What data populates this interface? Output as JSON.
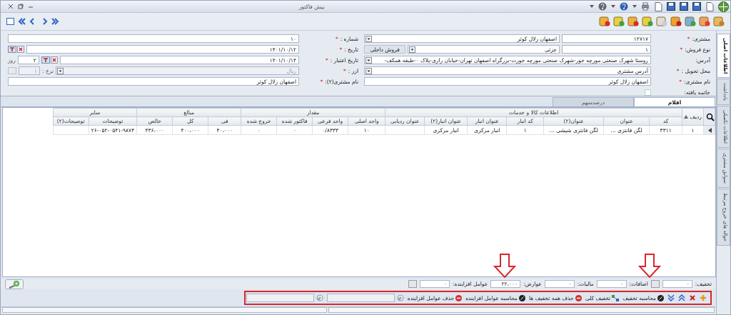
{
  "window": {
    "title": "پیش فاکتور"
  },
  "header_form": {
    "right": [
      {
        "label": "مشتری:",
        "required": "*",
        "fields": [
          {
            "kind": "code",
            "value": "۱۲۷۱۷",
            "disabled": false
          },
          {
            "kind": "combo",
            "value": "اصفهان زلال کوثر",
            "disabled": false
          }
        ]
      },
      {
        "label": "نوع فروش:",
        "required": "*",
        "fields": [
          {
            "kind": "code",
            "value": "۱",
            "disabled": false
          },
          {
            "kind": "combo",
            "value": "جزئی",
            "disabled": false
          },
          {
            "kind": "tag",
            "value": "فروش داخلی"
          }
        ]
      },
      {
        "label": "آدرس:",
        "fields": [
          {
            "kind": "combo",
            "value": "روستا شهرک صنعتی مورچه خور-شهرک صنعتی مورچه خورت-بزرگراه اصفهان تهران-خیابان رازی-پلاک ۰-طبقه همکف-",
            "disabled": false
          }
        ]
      },
      {
        "label": "محل تحویل :",
        "required": "*",
        "fields": [
          {
            "kind": "combo",
            "value": "آدرس مشتری",
            "disabled": false
          }
        ]
      },
      {
        "label": "نام مشتری:",
        "required": "*",
        "fields": [
          {
            "kind": "input",
            "value": "اصفهان زلال کوثر",
            "disabled": false
          }
        ]
      },
      {
        "label": "خاتمه یافته:",
        "fields": [
          {
            "kind": "checkbox",
            "checked": false
          }
        ]
      }
    ],
    "left": [
      {
        "label": "شماره :",
        "required": "*",
        "fields": [
          {
            "kind": "input",
            "value": "۱۰",
            "disabled": false
          }
        ]
      },
      {
        "label": "تاریخ :",
        "required": "*",
        "fields": [
          {
            "kind": "input",
            "value": "۱۴۰۱/۱۰/۱۲",
            "disabled": false
          },
          {
            "kind": "date-tools"
          }
        ]
      },
      {
        "label": "تاریخ اعتبار :",
        "required": "*",
        "fields": [
          {
            "kind": "input",
            "value": "۱۴۰۱/۱۰/۱۴",
            "disabled": false
          },
          {
            "kind": "date-tools"
          },
          {
            "kind": "small",
            "value": "۲",
            "disabled": false
          },
          {
            "kind": "unit",
            "value": "روز"
          }
        ]
      },
      {
        "label": "ارز :",
        "required": "*",
        "fields": [
          {
            "kind": "combo",
            "value": "ریال",
            "disabled": true
          },
          {
            "kind": "unit",
            "value": "نرخ :"
          },
          {
            "kind": "small",
            "value": "۱",
            "disabled": true
          },
          {
            "kind": "button",
            "disabled": true
          }
        ]
      },
      {
        "label": "نام مشتری(۲):",
        "required": "*",
        "fields": [
          {
            "kind": "input",
            "value": "اصفهان زلال کوثر",
            "disabled": false
          }
        ]
      }
    ]
  },
  "tabs": [
    {
      "label": "اقلام",
      "selected": true
    },
    {
      "label": "درصدسهم",
      "selected": false
    }
  ],
  "side_tabs": [
    {
      "label": "اطلاعات اصلی",
      "selected": true
    },
    {
      "label": "یادداشت",
      "selected": false
    },
    {
      "label": "اطلاعات تکمیلی",
      "selected": false
    },
    {
      "label": "سوابق مشتری",
      "selected": false
    },
    {
      "label": "حواله های خروج مرتبط",
      "selected": false
    }
  ],
  "items_table": {
    "row_header": "ردیف",
    "column_groups": [
      {
        "label": "اطلاعات کالا و خدمات",
        "columns": [
          "کد",
          "عنوان",
          "عنوان(۲)",
          "کد انبار",
          "عنوان انبار",
          "عنوان انبار(۲)",
          "عنوان ردیابی"
        ]
      },
      {
        "label": "مقدار",
        "columns": [
          "واحد اصلی",
          "واحد فرعی",
          "فاکتور شده",
          "خروج شده"
        ]
      },
      {
        "label": "مبالغ",
        "columns": [
          "فی",
          "کل",
          "خالص"
        ]
      },
      {
        "label": "سایر",
        "columns": [
          "توضیحات",
          "توضیحات(۲)"
        ]
      }
    ],
    "rows": [
      {
        "current": true,
        "cells": [
          "۱",
          "۳۳۱۱",
          "لگن فانتزی ...",
          "لگن فانتزی شیشی ...",
          "۱",
          "انبار مرکزی",
          "انبار مرکزی",
          null,
          "۱۰",
          "۰/۸۳۳۳",
          "۰",
          "۰",
          "۴۰،۰۰۰",
          "۴۰۰،۰۰۰",
          "۴۳۶،۰۰۰",
          "۲۶-۰۵۲-۰۵۴۱-۹۸۷۴",
          null
        ]
      }
    ]
  },
  "totals": [
    {
      "label": "تخفیف:",
      "value": "۰",
      "picker": true
    },
    {
      "label": "اضافات:",
      "value": "۰",
      "picker": false
    },
    {
      "label": "مالیات:",
      "value": "۰",
      "picker": false
    },
    {
      "label": "عوارض:",
      "value": "۲۲،۰۰۰",
      "picker": false
    },
    {
      "label": "عوامل افزاینده:",
      "value": "۰",
      "picker": true
    }
  ],
  "actions": [
    {
      "kind": "add"
    },
    {
      "kind": "delete"
    },
    {
      "kind": "move-up"
    },
    {
      "kind": "move-down"
    },
    {
      "kind": "calc",
      "label": "محاسبه تخفیف"
    },
    {
      "kind": "split",
      "label": "تخفیف کلی"
    },
    {
      "kind": "remove",
      "label": "حذف همه تخفیف ها"
    },
    {
      "kind": "calc",
      "label": "محاسبه عوامل افزاینده"
    },
    {
      "kind": "remove",
      "label": "حذف عوامل افزاینده"
    },
    {
      "kind": "lookup"
    },
    {
      "kind": "lookup"
    }
  ],
  "annotations": {
    "frame": true,
    "arrows": [
      {
        "kind": "down-arrow"
      },
      {
        "kind": "down-arrow"
      }
    ]
  }
}
